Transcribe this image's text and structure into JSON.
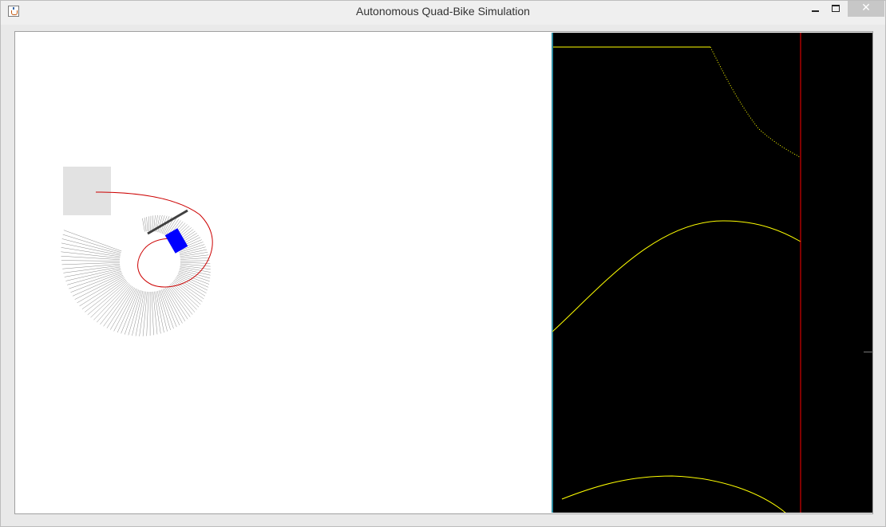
{
  "window": {
    "title": "Autonomous Quad-Bike Simulation",
    "icon": "java-cup-icon",
    "controls": {
      "minimize_icon": "minimize-icon",
      "maximize_icon": "maximize-icon",
      "close_label": "✕"
    }
  },
  "simulation": {
    "background": "#ffffff",
    "vehicle_color": "#0000ff",
    "path_color": "#cc0000",
    "sensor_ray_color": "#8a8a8a",
    "obstacle_color": "#404040"
  },
  "graph": {
    "background": "#000000",
    "curve_color": "#ffff00",
    "marker_color": "#ff0000",
    "axis_color": "#2d8aa0"
  }
}
